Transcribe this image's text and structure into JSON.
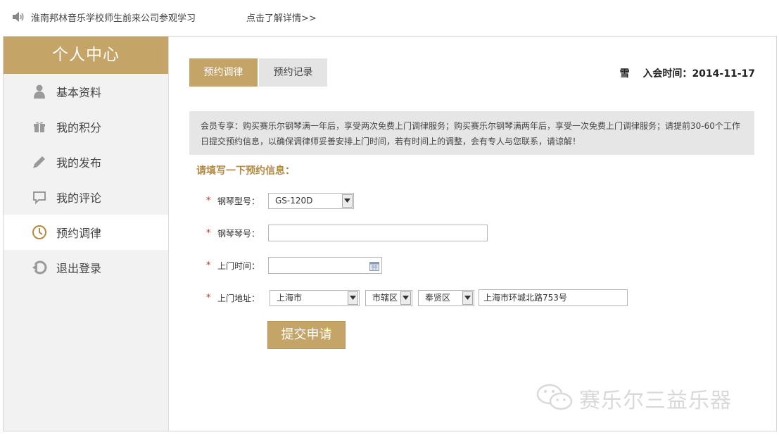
{
  "topbar": {
    "notice": "淮南邦林音乐学校师生前来公司参观学习",
    "more_link": "点击了解详情>>"
  },
  "sidebar": {
    "title": "个人中心",
    "items": [
      {
        "label": "基本资料",
        "icon": "user-icon"
      },
      {
        "label": "我的积分",
        "icon": "gift-icon"
      },
      {
        "label": "我的发布",
        "icon": "pencil-icon"
      },
      {
        "label": "我的评论",
        "icon": "comment-icon"
      },
      {
        "label": "预约调律",
        "icon": "clock-icon",
        "active": true
      },
      {
        "label": "退出登录",
        "icon": "logout-icon"
      }
    ]
  },
  "tabs": [
    {
      "label": "预约调律",
      "active": true
    },
    {
      "label": "预约记录",
      "active": false
    }
  ],
  "member": {
    "name": "雪",
    "join_label": "入会时间：",
    "join_date": "2014-11-17"
  },
  "notice_text": "会员专享：购买赛乐尔钢琴满一年后，享受两次免费上门调律服务；购买赛乐尔钢琴满两年后，享受一次免费上门调律服务；请提前30-60个工作日提交预约信息，以确保调律师妥善安排上门时间，若有时间上的调整，会有专人与您联系，请谅解！",
  "form": {
    "title": "请填写一下预约信息：",
    "required_mark": "*",
    "model": {
      "label": "钢琴型号：",
      "value": "GS-120D"
    },
    "serial": {
      "label": "钢琴琴号：",
      "value": ""
    },
    "time": {
      "label": "上门时间：",
      "value": ""
    },
    "address": {
      "label": "上门地址：",
      "city": "上海市",
      "district": "市辖区",
      "area": "奉贤区",
      "street": "上海市环城北路753号"
    },
    "submit_label": "提交申请"
  },
  "watermark": {
    "text": "赛乐尔三益乐器"
  },
  "colors": {
    "accent": "#c4a467",
    "title_gold": "#b08a43",
    "required": "#c0392b"
  }
}
